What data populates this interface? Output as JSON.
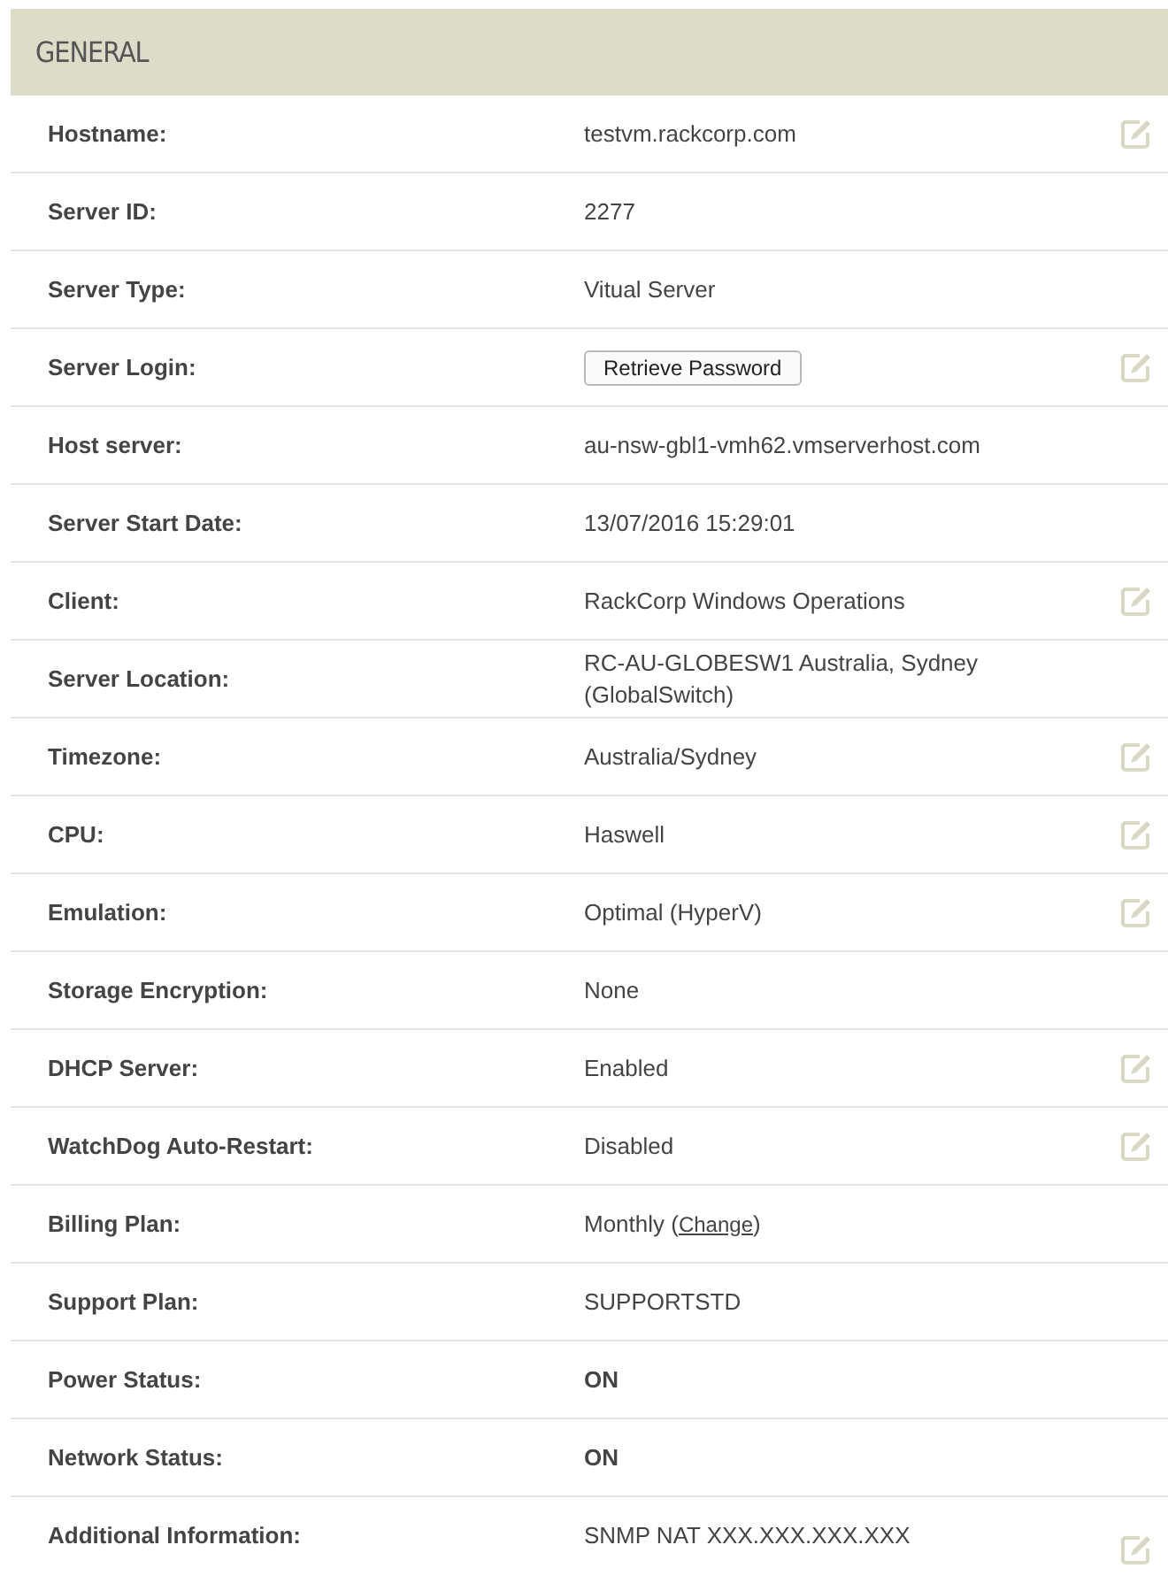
{
  "section": {
    "title": "GENERAL"
  },
  "rows": [
    {
      "label": "Hostname:",
      "kind": "text",
      "value": "testvm.rackcorp.com",
      "editable": true
    },
    {
      "label": "Server ID:",
      "kind": "text",
      "value": "2277",
      "editable": false
    },
    {
      "label": "Server Type:",
      "kind": "text",
      "value": "Vitual Server",
      "editable": false
    },
    {
      "label": "Server Login:",
      "kind": "button",
      "value": "Retrieve Password",
      "editable": true
    },
    {
      "label": "Host server:",
      "kind": "text",
      "value": "au-nsw-gbl1-vmh62.vmserverhost.com",
      "editable": false
    },
    {
      "label": "Server Start Date:",
      "kind": "text",
      "value": "13/07/2016 15:29:01",
      "editable": false
    },
    {
      "label": "Client:",
      "kind": "text",
      "value": "RackCorp Windows Operations",
      "editable": true
    },
    {
      "label": "Server Location:",
      "kind": "text",
      "value": "RC-AU-GLOBESW1 Australia, Sydney (GlobalSwitch)",
      "editable": false
    },
    {
      "label": "Timezone:",
      "kind": "text",
      "value": "Australia/Sydney",
      "editable": true
    },
    {
      "label": "CPU:",
      "kind": "text",
      "value": "Haswell",
      "editable": true
    },
    {
      "label": "Emulation:",
      "kind": "text",
      "value": "Optimal (HyperV)",
      "editable": true
    },
    {
      "label": "Storage Encryption:",
      "kind": "text",
      "value": "None",
      "editable": false
    },
    {
      "label": "DHCP Server:",
      "kind": "text",
      "value": "Enabled",
      "editable": true
    },
    {
      "label": "WatchDog Auto-Restart:",
      "kind": "text",
      "value": "Disabled",
      "editable": true
    },
    {
      "label": "Billing Plan:",
      "kind": "link",
      "value": "Monthly (",
      "link": "Change",
      "after": ")",
      "editable": false
    },
    {
      "label": "Support Plan:",
      "kind": "text",
      "value": "SUPPORTSTD",
      "editable": false
    },
    {
      "label": "Power Status:",
      "kind": "status",
      "value": "ON",
      "editable": false
    },
    {
      "label": "Network Status:",
      "kind": "status",
      "value": "ON",
      "editable": false
    },
    {
      "label": "Additional Information:",
      "kind": "text",
      "value": "SNMP NAT XXX.XXX.XXX.XXX",
      "editable": true
    }
  ]
}
